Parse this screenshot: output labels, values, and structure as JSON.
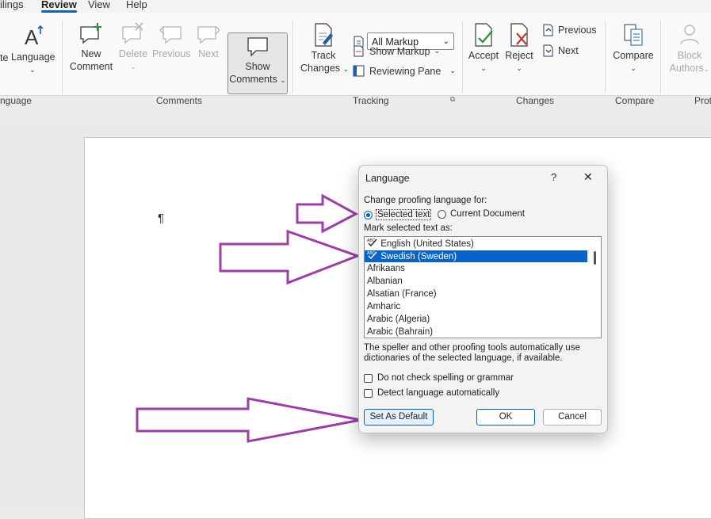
{
  "menu_tabs": [
    "ilings",
    "Review",
    "View",
    "Help"
  ],
  "ribbon": {
    "language_group": {
      "partial_label": "te",
      "language_button": "Language",
      "group_label": "nguage"
    },
    "comments_group": {
      "new_comment": [
        "New",
        "Comment"
      ],
      "delete": "Delete",
      "previous": "Previous",
      "next": "Next",
      "show_comments": [
        "Show",
        "Comments"
      ],
      "group_label": "Comments"
    },
    "tracking_group": {
      "track_changes": [
        "Track",
        "Changes"
      ],
      "markup_select": "All Markup",
      "show_markup": "Show Markup",
      "reviewing_pane": "Reviewing Pane",
      "group_label": "Tracking"
    },
    "changes_group": {
      "accept": "Accept",
      "reject": "Reject",
      "previous": "Previous",
      "next": "Next",
      "group_label": "Changes"
    },
    "compare_group": {
      "compare": "Compare",
      "group_label": "Compare"
    },
    "protect_group": {
      "block_authors": [
        "Block",
        "Authors"
      ],
      "group_label": "Prot"
    }
  },
  "document": {
    "cursor_glyph": "¶"
  },
  "dialog": {
    "title": "Language",
    "help": "?",
    "close": "✕",
    "change_for_label": "Change proofing language for:",
    "radio_selected_text": "Selected text",
    "radio_current_document": "Current Document",
    "radio_selected": "selected_text",
    "mark_as_label": "Mark selected text as:",
    "languages": [
      {
        "name": "English (United States)",
        "spell_icon": true,
        "selected": false
      },
      {
        "name": "Swedish (Sweden)",
        "spell_icon": true,
        "selected": true
      },
      {
        "name": "Afrikaans",
        "spell_icon": false,
        "selected": false
      },
      {
        "name": "Albanian",
        "spell_icon": false,
        "selected": false
      },
      {
        "name": "Alsatian (France)",
        "spell_icon": false,
        "selected": false
      },
      {
        "name": "Amharic",
        "spell_icon": false,
        "selected": false
      },
      {
        "name": "Arabic (Algeria)",
        "spell_icon": false,
        "selected": false
      },
      {
        "name": "Arabic (Bahrain)",
        "spell_icon": false,
        "selected": false
      }
    ],
    "info_line1": "The speller and other proofing tools automatically use",
    "info_line2": "dictionaries of the selected language, if available.",
    "no_check_label": "Do not check spelling or grammar",
    "no_check_checked": false,
    "detect_label": "Detect language automatically",
    "detect_checked": false,
    "set_default_button": "Set As Default",
    "ok_button": "OK",
    "cancel_button": "Cancel"
  },
  "colors": {
    "annotation_arrow": "#9b3fa6",
    "selection": "#0a64c8",
    "accent": "#1b5fa8"
  }
}
